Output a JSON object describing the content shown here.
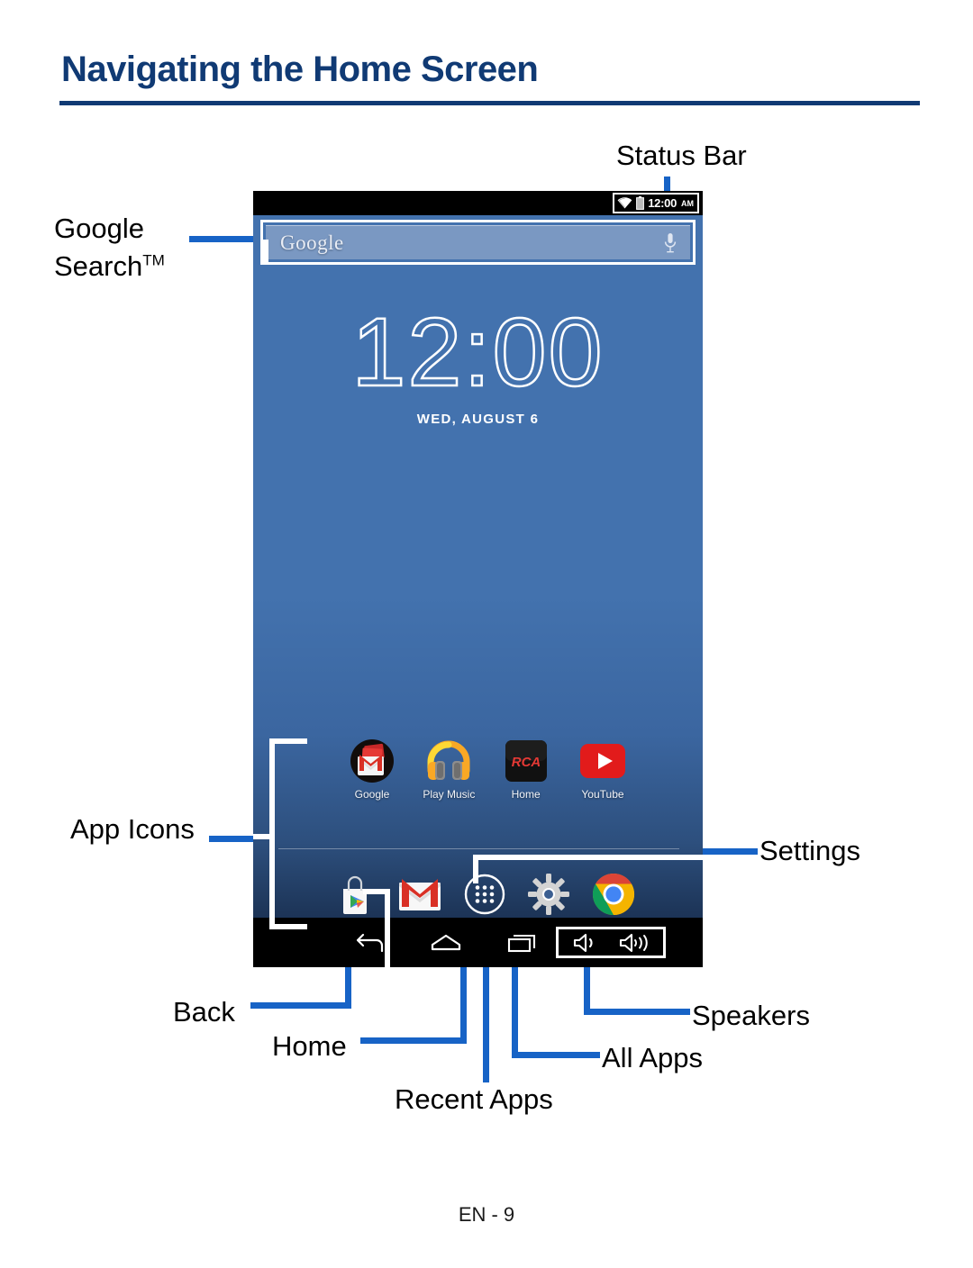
{
  "page": {
    "title": "Navigating the Home Screen",
    "footer": "EN - 9"
  },
  "device": {
    "status_bar": {
      "time": "12:00",
      "ampm": "AM",
      "icons": [
        "wifi-icon",
        "battery-icon"
      ]
    },
    "search_widget": {
      "brand": "Google",
      "mic_icon": "microphone-icon"
    },
    "clock_widget": {
      "time": "12:00",
      "date": "WED, AUGUST 6"
    },
    "app_icons": [
      {
        "label": "Google",
        "icon": "gmail-bundle-icon"
      },
      {
        "label": "Play Music",
        "icon": "headphones-icon"
      },
      {
        "label": "Home",
        "icon": "rca-logo-icon"
      },
      {
        "label": "YouTube",
        "icon": "youtube-icon"
      }
    ],
    "dock": [
      {
        "name": "Play Store",
        "icon": "play-store-icon"
      },
      {
        "name": "Gmail",
        "icon": "gmail-icon"
      },
      {
        "name": "All Apps",
        "icon": "all-apps-grid-icon"
      },
      {
        "name": "Settings",
        "icon": "gear-icon"
      },
      {
        "name": "Chrome",
        "icon": "chrome-icon"
      }
    ],
    "nav_bar": [
      {
        "name": "Back",
        "icon": "back-arrow-icon"
      },
      {
        "name": "Home",
        "icon": "home-icon"
      },
      {
        "name": "Recent Apps",
        "icon": "recent-apps-icon"
      }
    ],
    "speakers": [
      {
        "icon": "speaker-low-icon"
      },
      {
        "icon": "speaker-high-icon"
      }
    ]
  },
  "callouts": {
    "status_bar": "Status Bar",
    "google_search": "Google",
    "google_search_2": "Search",
    "google_search_tm": "TM",
    "app_icons": "App Icons",
    "settings": "Settings",
    "back": "Back",
    "home": "Home",
    "recent_apps": "Recent Apps",
    "all_apps": "All Apps",
    "speakers": "Speakers"
  },
  "colors": {
    "accent_blue": "#1763c6",
    "title_navy": "#103a74",
    "wallpaper_blue": "#4372ae"
  }
}
